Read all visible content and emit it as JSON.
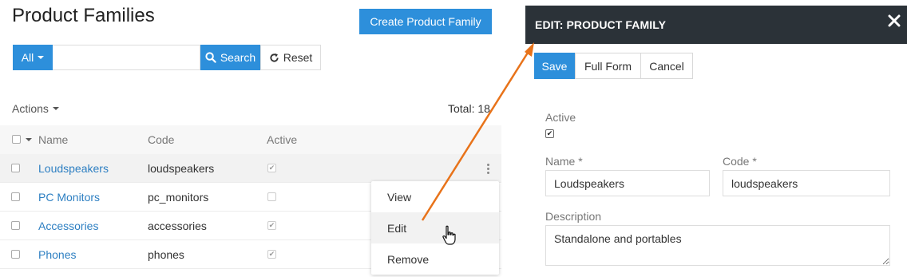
{
  "page": {
    "title": "Product Families",
    "create_button": "Create Product Family"
  },
  "filters": {
    "all_label": "All",
    "search_placeholder": "",
    "search_label": "Search",
    "reset_label": "Reset"
  },
  "toolbar": {
    "actions_label": "Actions",
    "total_label": "Total: 18"
  },
  "grid": {
    "columns": [
      "Name",
      "Code",
      "Active"
    ],
    "rows": [
      {
        "name": "Loudspeakers",
        "code": "loudspeakers",
        "active": true
      },
      {
        "name": "PC Monitors",
        "code": "pc_monitors",
        "active": false
      },
      {
        "name": "Accessories",
        "code": "accessories",
        "active": true
      },
      {
        "name": "Phones",
        "code": "phones",
        "active": true
      }
    ]
  },
  "row_menu": {
    "items": [
      "View",
      "Edit",
      "Remove"
    ],
    "hovered": "Edit"
  },
  "edit_panel": {
    "title": "EDIT: PRODUCT FAMILY",
    "save_label": "Save",
    "full_form_label": "Full Form",
    "cancel_label": "Cancel",
    "active_label": "Active",
    "active_checked": true,
    "name_label": "Name *",
    "name_value": "Loudspeakers",
    "code_label": "Code *",
    "code_value": "loudspeakers",
    "description_label": "Description",
    "description_value": "Standalone and portables"
  },
  "colors": {
    "primary": "#2d8fdb",
    "panel_header": "#2b3238",
    "link": "#2d7fc2",
    "arrow": "#e8731a"
  },
  "icons": [
    "search-icon",
    "refresh-icon",
    "close-icon",
    "kebab-icon",
    "hand-cursor-icon",
    "caret-down-icon"
  ]
}
